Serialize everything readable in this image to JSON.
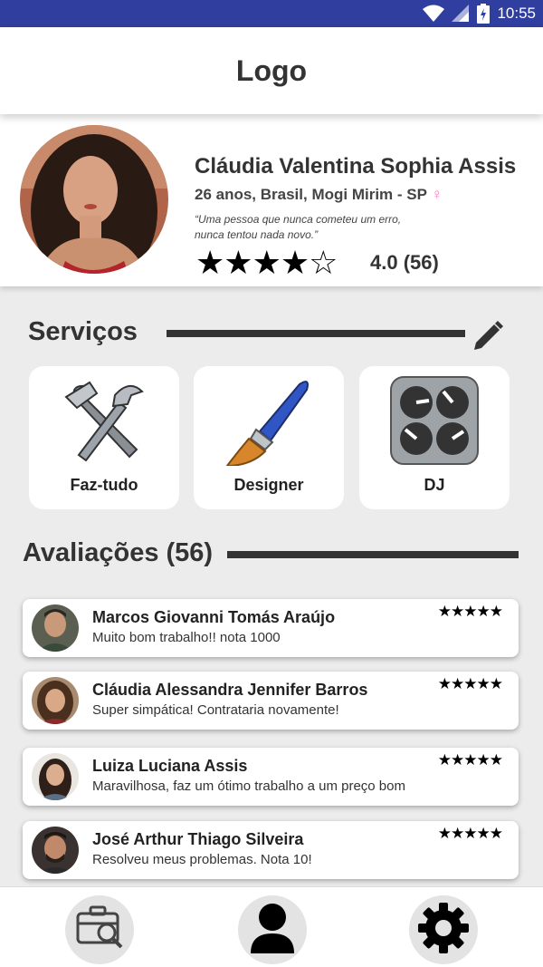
{
  "status_bar": {
    "time": "10:55",
    "icons": [
      "wifi-icon",
      "signal-icon",
      "battery-charging-icon"
    ]
  },
  "app_bar": {
    "logo": "Logo"
  },
  "profile": {
    "name": "Cláudia Valentina Sophia Assis",
    "details": "26 anos, Brasil, Mogi Mirim - SP",
    "gender_symbol": "♀",
    "quote_line1": "“Uma pessoa que nunca cometeu um erro,",
    "quote_line2": "nunca tentou nada novo.”",
    "rating": 4.0,
    "max_rating": 5,
    "rating_text": "4.0 (56)",
    "stars_display": [
      "★",
      "★",
      "★",
      "★",
      "☆"
    ]
  },
  "services": {
    "title": "Serviços",
    "edit_icon": "pencil-icon",
    "items": [
      {
        "label": "Faz-tudo",
        "icon": "tools-icon"
      },
      {
        "label": "Designer",
        "icon": "paintbrush-icon"
      },
      {
        "label": "DJ",
        "icon": "mixer-knobs-icon"
      }
    ]
  },
  "reviews": {
    "title": "Avaliações (56)",
    "items": [
      {
        "name": "Marcos Giovanni Tomás Araújo",
        "text": "Muito bom trabalho!! nota 1000",
        "stars": "★★★★★",
        "rating": 5
      },
      {
        "name": "Cláudia Alessandra Jennifer Barros",
        "text": "Super simpática! Contrataria novamente!",
        "stars": "★★★★★",
        "rating": 5
      },
      {
        "name": "Luiza Luciana Assis",
        "text": "Maravilhosa, faz um ótimo trabalho a um preço bom",
        "stars": "★★★★★",
        "rating": 5
      },
      {
        "name": "José Arthur Thiago Silveira",
        "text": "Resolveu meus problemas. Nota 10!",
        "stars": "★★★★★",
        "rating": 5
      }
    ]
  },
  "bottom_nav": {
    "items": [
      {
        "icon": "briefcase-search-icon"
      },
      {
        "icon": "user-icon"
      },
      {
        "icon": "gear-icon"
      }
    ]
  },
  "colors": {
    "status_bar": "#303f9f",
    "background": "#ececec",
    "gender": "#ff7fbf"
  }
}
